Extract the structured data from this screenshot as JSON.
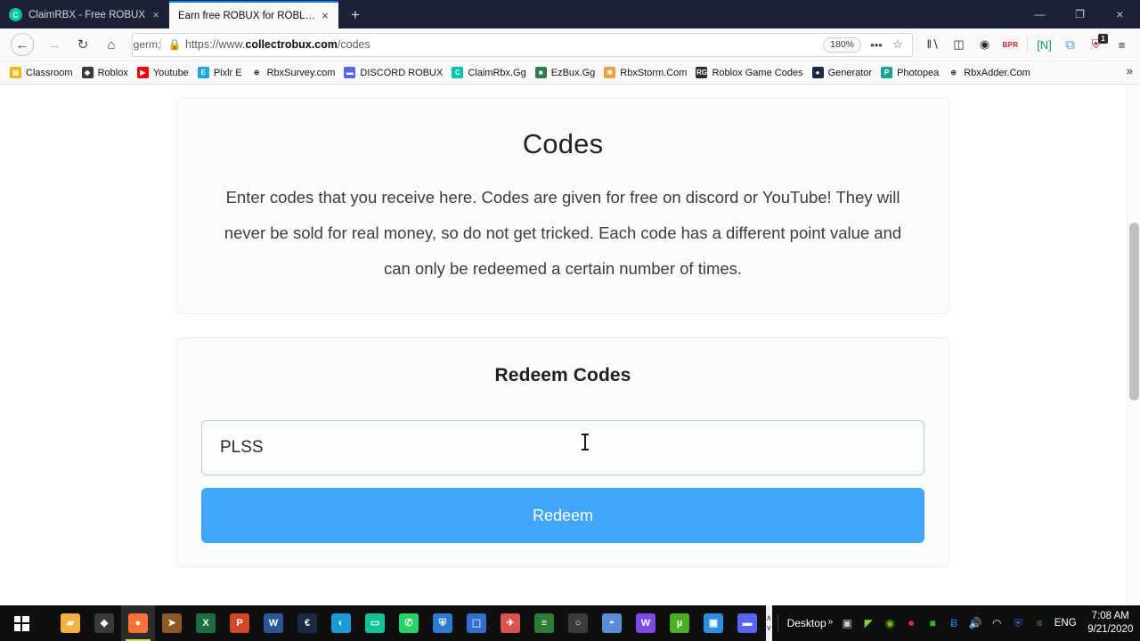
{
  "browser": {
    "tabs": [
      {
        "title": "ClaimRBX - Free ROBUX",
        "favicon": "claimrbx-icon",
        "active": false
      },
      {
        "title": "Earn free ROBUX for ROBLOX!",
        "favicon": "page-icon",
        "active": true
      }
    ],
    "new_tab_label": "+",
    "tab_close_label": "×",
    "window_controls": {
      "minimize": "—",
      "maximize": "❐",
      "close": "×"
    },
    "nav": {
      "back": "←",
      "forward": "→",
      "reload": "↻",
      "home": "⌂"
    },
    "url": {
      "shield_icon": "shield-icon",
      "lock_icon": "lock-icon",
      "prefix": "https://www.",
      "domain": "collectrobux.com",
      "path": "/codes",
      "zoom_level": "180%",
      "page_actions": "•••",
      "bookmark_star": "☆"
    },
    "toolbar_icons": [
      {
        "name": "library-icon",
        "glyph": "‖∖",
        "style": ""
      },
      {
        "name": "sidebar-icon",
        "glyph": "◫",
        "style": ""
      },
      {
        "name": "account-icon",
        "glyph": "◉",
        "style": ""
      },
      {
        "name": "bpr-extension-icon",
        "glyph": "BPR",
        "style": "red-text"
      },
      {
        "name": "nimbus-screenshot-icon",
        "glyph": "[N]",
        "style": "nimbus"
      },
      {
        "name": "tab-manager-icon",
        "glyph": "⧉",
        "style": "blue"
      },
      {
        "name": "ublock-origin-icon",
        "glyph": "⛨",
        "style": "",
        "badge": "1"
      },
      {
        "name": "menu-icon",
        "glyph": "≡",
        "style": ""
      }
    ],
    "bookmarks": [
      {
        "label": "Classroom",
        "icon_color": "#f4b400",
        "icon_letter": "▤"
      },
      {
        "label": "Roblox",
        "icon_color": "#3b3b3b",
        "icon_letter": "◆"
      },
      {
        "label": "Youtube",
        "icon_color": "#ff0000",
        "icon_letter": "▶"
      },
      {
        "label": "Pixlr E",
        "icon_color": "#1ea7e1",
        "icon_letter": "E"
      },
      {
        "label": "RbxSurvey.com",
        "icon_color": "#ffffff",
        "icon_letter": "⊕"
      },
      {
        "label": "DISCORD ROBUX",
        "icon_color": "#5865f2",
        "icon_letter": "▬"
      },
      {
        "label": "ClaimRbx.Gg",
        "icon_color": "#00c6a7",
        "icon_letter": "C"
      },
      {
        "label": "EzBux.Gg",
        "icon_color": "#2f7d4f",
        "icon_letter": "■"
      },
      {
        "label": "RbxStorm.Com",
        "icon_color": "#e8a33d",
        "icon_letter": "✻"
      },
      {
        "label": "Roblox Game Codes",
        "icon_color": "#2b2b2b",
        "icon_letter": "RG"
      },
      {
        "label": "Generator",
        "icon_color": "#1b2a44",
        "icon_letter": "●"
      },
      {
        "label": "Photopea",
        "icon_color": "#18a497",
        "icon_letter": "P"
      },
      {
        "label": "RbxAdder.Com",
        "icon_color": "#ffffff",
        "icon_letter": "⊕"
      }
    ],
    "bookmarks_overflow": "»"
  },
  "page": {
    "intro_card": {
      "title": "Codes",
      "paragraph": "Enter codes that you receive here. Codes are given for free on discord or YouTube! They will never be sold for real money, so do not get tricked. Each code has a different point value and can only be redeemed a certain number of times."
    },
    "redeem_card": {
      "title": "Redeem Codes",
      "input_value": "PLSS",
      "input_placeholder": "",
      "button_label": "Redeem",
      "button_color": "#40a6fa"
    }
  },
  "taskbar": {
    "start_label": "start-button",
    "apps": [
      {
        "name": "file-explorer",
        "glyph": "▰",
        "color": "#f2b33d"
      },
      {
        "name": "dark-app",
        "glyph": "◆",
        "color": "#3a3a3a"
      },
      {
        "name": "firefox",
        "glyph": "●",
        "color": "#ff7139",
        "active": true
      },
      {
        "name": "sharpen-tool",
        "glyph": "➤",
        "color": "#8b5a2b"
      },
      {
        "name": "excel",
        "glyph": "X",
        "color": "#1d6f42"
      },
      {
        "name": "powerpoint",
        "glyph": "P",
        "color": "#d24726"
      },
      {
        "name": "word",
        "glyph": "W",
        "color": "#2b579a"
      },
      {
        "name": "cheat-engine",
        "glyph": "€",
        "color": "#1b2a44"
      },
      {
        "name": "bluestacks",
        "glyph": "◐",
        "color": "#1a9ad7"
      },
      {
        "name": "messenger-app",
        "glyph": "▭",
        "color": "#13c296"
      },
      {
        "name": "whatsapp",
        "glyph": "✆",
        "color": "#25d366"
      },
      {
        "name": "security-shield",
        "glyph": "⛨",
        "color": "#2a7bd4"
      },
      {
        "name": "game-launcher",
        "glyph": "⬚",
        "color": "#2f6fd0"
      },
      {
        "name": "rocket-app",
        "glyph": "✈",
        "color": "#d9534f"
      },
      {
        "name": "ram-cleaner",
        "glyph": "≡",
        "color": "#2e7d32"
      },
      {
        "name": "obs-studio",
        "glyph": "○",
        "color": "#3c3c3c"
      },
      {
        "name": "winrar",
        "glyph": "◓",
        "color": "#5b8dd6"
      },
      {
        "name": "wondershare",
        "glyph": "W",
        "color": "#7b4ae2"
      },
      {
        "name": "utorrent",
        "glyph": "µ",
        "color": "#4caf22"
      },
      {
        "name": "media-app",
        "glyph": "▣",
        "color": "#2a8fe0"
      },
      {
        "name": "discord",
        "glyph": "▬",
        "color": "#5865f2"
      }
    ],
    "scroll_up": "∧",
    "scroll_down": "∨",
    "tray": {
      "desktop_label": "Desktop",
      "desktop_overflow": "»",
      "icons": [
        {
          "name": "display-icon",
          "glyph": "▣",
          "color": "#cfcfcf"
        },
        {
          "name": "graph-monitor-icon",
          "glyph": "◤",
          "color": "#7fd44a"
        },
        {
          "name": "nvidia-icon",
          "glyph": "◉",
          "color": "#76b900"
        },
        {
          "name": "record-icon",
          "glyph": "⏺",
          "color": "#e03030"
        },
        {
          "name": "green-app-icon",
          "glyph": "■",
          "color": "#25c025"
        },
        {
          "name": "bluetooth-icon",
          "glyph": "Ƀ",
          "color": "#1a8fe0"
        },
        {
          "name": "volume-icon",
          "glyph": "🔊",
          "color": "#e8e8e8"
        },
        {
          "name": "wifi-icon",
          "glyph": "◠",
          "color": "#e8e8e8"
        },
        {
          "name": "antivirus-shield-icon",
          "glyph": "⛨",
          "color": "#2a7bd4"
        },
        {
          "name": "ram-tray-icon",
          "glyph": "≡",
          "color": "#2e9e3a"
        }
      ],
      "language": "ENG",
      "time": "7:08 AM",
      "date": "9/21/2020",
      "notification_icon": "☰"
    }
  }
}
